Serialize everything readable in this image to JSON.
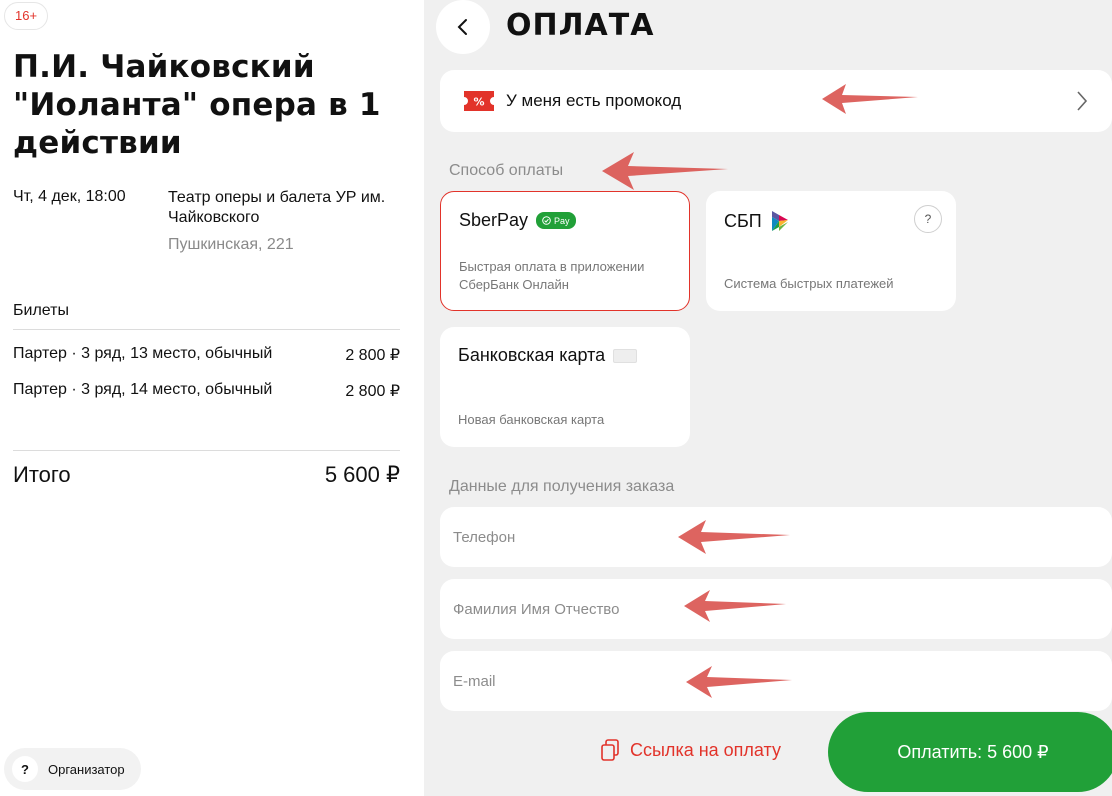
{
  "left": {
    "age_rating": "16+",
    "title": "П.И. Чайковский \"Иоланта\" опера в 1 действии",
    "date": "Чт, 4 дек, 18:00",
    "venue_name": "Театр оперы и балета УР им. Чайковского",
    "venue_address": "Пушкинская, 221",
    "tickets_label": "Билеты",
    "tickets": [
      {
        "desc": "Партер · 3 ряд, 13 место, обычный",
        "price": "2 800 ₽"
      },
      {
        "desc": "Партер · 3 ряд, 14 место, обычный",
        "price": "2 800 ₽"
      }
    ],
    "total_label": "Итого",
    "total_value": "5 600 ₽",
    "organizer_label": "Организатор"
  },
  "right": {
    "title": "ОПЛАТА",
    "promo_label": "У меня есть промокод",
    "payment_section_label": "Способ оплаты",
    "methods": {
      "sberpay": {
        "title": "SberPay",
        "badge": "Pay",
        "desc": "Быстрая оплата в приложении СберБанк Онлайн"
      },
      "sbp": {
        "title": "СБП",
        "desc": "Система быстрых платежей"
      },
      "card": {
        "title": "Банковская карта",
        "desc": "Новая банковская карта"
      }
    },
    "order_section_label": "Данные для получения заказа",
    "fields": {
      "phone_placeholder": "Телефон",
      "name_placeholder": "Фамилия Имя Отчество",
      "email_placeholder": "E-mail"
    },
    "payment_link_label": "Ссылка на оплату",
    "pay_button_label": "Оплатить: 5 600 ₽"
  },
  "colors": {
    "accent_red": "#e2332a",
    "green": "#21a038",
    "annotation_arrow": "#d9534f"
  }
}
